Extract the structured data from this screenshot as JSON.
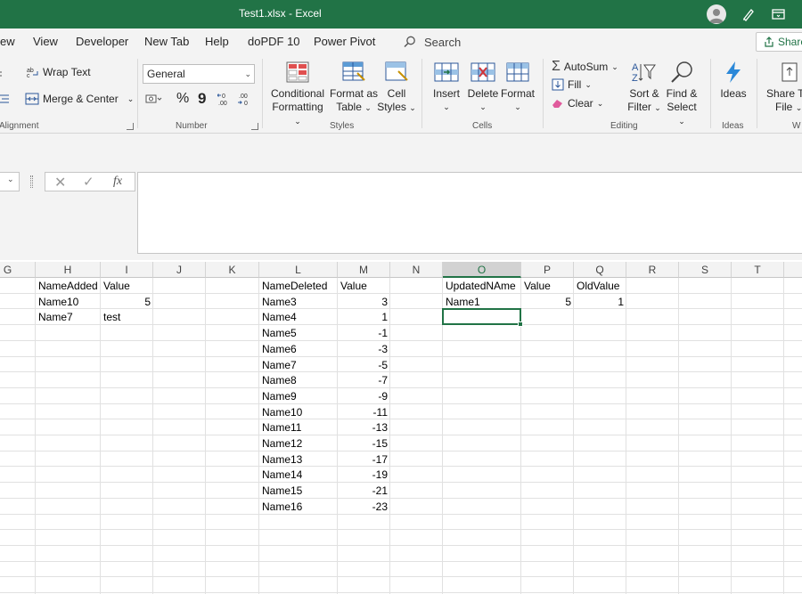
{
  "app": {
    "title": "Test1.xlsx  -  Excel",
    "colors": {
      "brand": "#217346",
      "ribbon_bg": "#f3f3f3",
      "grid_line": "#e1e1e1"
    }
  },
  "menu": {
    "tabs": [
      "ew",
      "View",
      "Developer",
      "New Tab",
      "Help",
      "doPDF 10",
      "Power Pivot"
    ],
    "search_label": "Search",
    "share_label": "Share"
  },
  "ribbon": {
    "alignment": {
      "wrap_text": "Wrap Text",
      "merge_center": "Merge & Center",
      "group_label": "Alignment"
    },
    "number": {
      "format_value": "General",
      "percent": "%",
      "comma": "9",
      "group_label": "Number"
    },
    "styles": {
      "conditional_formatting": [
        "Conditional",
        "Formatting"
      ],
      "format_as_table": [
        "Format as",
        "Table"
      ],
      "cell_styles": [
        "Cell",
        "Styles"
      ],
      "group_label": "Styles"
    },
    "cells": {
      "insert": "Insert",
      "delete": "Delete",
      "format": "Format",
      "group_label": "Cells"
    },
    "editing": {
      "autosum": "AutoSum",
      "fill": "Fill",
      "clear": "Clear",
      "sort_filter": [
        "Sort &",
        "Filter"
      ],
      "find_select": [
        "Find &",
        "Select"
      ],
      "group_label": "Editing"
    },
    "ideas": {
      "label": "Ideas",
      "group_label": "Ideas"
    },
    "share_file": {
      "label": [
        "Share Th",
        "File"
      ],
      "group_label": "W"
    }
  },
  "formula_bar": {
    "fx": "fx",
    "content": ""
  },
  "grid": {
    "columns": [
      "G",
      "H",
      "I",
      "J",
      "K",
      "L",
      "M",
      "N",
      "O",
      "P",
      "Q",
      "R",
      "S",
      "T"
    ],
    "selected_column": "O",
    "selected_cell": "O3",
    "cells": {
      "H1": "NameAdded",
      "I1": "Value",
      "H2": "Name10",
      "I2": "5",
      "H3": "Name7",
      "I3": "test",
      "L1": "NameDeleted",
      "M1": "Value",
      "L2": "Name3",
      "M2": "3",
      "L3": "Name4",
      "M3": "1",
      "L4": "Name5",
      "M4": "-1",
      "L5": "Name6",
      "M5": "-3",
      "L6": "Name7",
      "M6": "-5",
      "L7": "Name8",
      "M7": "-7",
      "L8": "Name9",
      "M8": "-9",
      "L9": "Name10",
      "M9": "-11",
      "L10": "Name11",
      "M10": "-13",
      "L11": "Name12",
      "M11": "-15",
      "L12": "Name13",
      "M12": "-17",
      "L13": "Name14",
      "M13": "-19",
      "L14": "Name15",
      "M14": "-21",
      "L15": "Name16",
      "M15": "-23",
      "O1": "UpdatedNAme",
      "P1": "Value",
      "Q1": "OldValue",
      "O2": "Name1",
      "P2": "5",
      "Q2": "1"
    },
    "numeric_cells": [
      "I2",
      "M2",
      "M3",
      "M4",
      "M5",
      "M6",
      "M7",
      "M8",
      "M9",
      "M10",
      "M11",
      "M12",
      "M13",
      "M14",
      "M15",
      "P2",
      "Q2"
    ]
  }
}
